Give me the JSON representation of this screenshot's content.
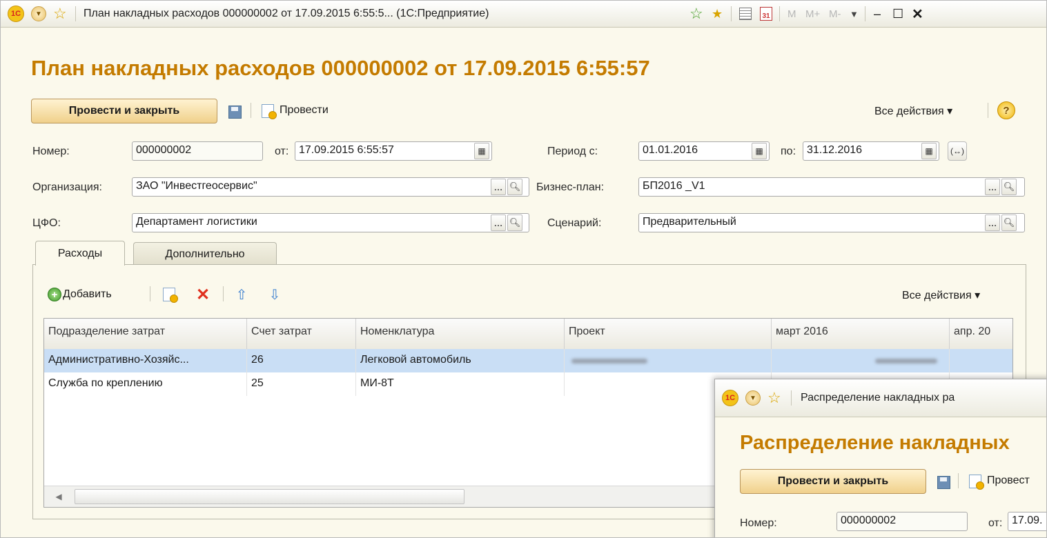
{
  "window": {
    "title": "План накладных расходов 000000002 от 17.09.2015 6:55:5... (1С:Предприятие)",
    "memory_buttons": [
      "M",
      "M+",
      "M-"
    ],
    "header": "План накладных расходов 000000002 от 17.09.2015 6:55:57"
  },
  "toolbar": {
    "post_and_close": "Провести и закрыть",
    "post": "Провести",
    "all_actions": "Все действия ▾",
    "help": "?"
  },
  "form": {
    "number_label": "Номер:",
    "number_value": "000000002",
    "date_label": "от:",
    "date_value": "17.09.2015  6:55:57",
    "period_from_label": "Период с:",
    "period_from_value": "01.01.2016",
    "period_to_label": "по:",
    "period_to_value": "31.12.2016",
    "org_label": "Организация:",
    "org_value": "ЗАО \"Инвестгеосервис\"",
    "plan_label": "Бизнес-план:",
    "plan_value": "БП2016 _V1",
    "cfo_label": "ЦФО:",
    "cfo_value": "Департамент логистики",
    "scenario_label": "Сценарий:",
    "scenario_value": "Предварительный"
  },
  "tabs": [
    "Расходы",
    "Дополнительно"
  ],
  "table_toolbar": {
    "add": "Добавить",
    "all_actions": "Все действия ▾"
  },
  "table": {
    "columns": [
      "Подразделение затрат",
      "Счет затрат",
      "Номенклатура",
      "Проект",
      "март 2016",
      "апр. 20"
    ],
    "rows": [
      [
        "Административно-Хозяйс...",
        "26",
        "Легковой автомобиль"
      ],
      [
        "Служба по креплению",
        "25",
        "МИ-8Т"
      ]
    ]
  },
  "second_window": {
    "title": "Распределение накладных ра",
    "header": "Распределение накладных",
    "post_and_close": "Провести и закрыть",
    "post": "Провест",
    "number_label": "Номер:",
    "number_value": "000000002",
    "date_label": "от:",
    "date_value": "17.09."
  },
  "colors": {
    "header_text": "#c47b00",
    "window_bg": "#fbf9ec",
    "selected_row": "#c9def5"
  }
}
